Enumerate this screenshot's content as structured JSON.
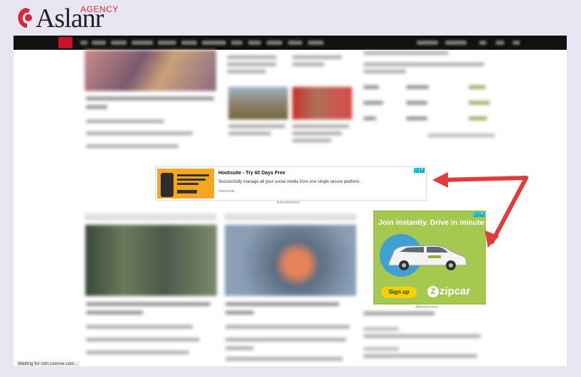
{
  "brand": {
    "logo_text": "Aslanr",
    "agency_label": "AGENCY",
    "accent": "#d7263d"
  },
  "status_bar": {
    "text": "Waiting for cdn.cxense.com..."
  },
  "ad_top": {
    "headline": "Hootsuite - Try 60 Days Free",
    "description": "Successfully manage all your social media from one single secure platform.",
    "source": "Hootsuite",
    "label": "Advertisement",
    "adchoice_icon": "adchoices-icon",
    "close_icon": "close-icon"
  },
  "ad_side": {
    "headline": "Join instantly. Drive in minutes.",
    "cta": "Sign up",
    "brand": "zipcar",
    "label": "Advertisement",
    "bg_color": "#a5c94f"
  },
  "annotation": {
    "color": "#e23b3b",
    "icon": "red-arrow-icon"
  }
}
